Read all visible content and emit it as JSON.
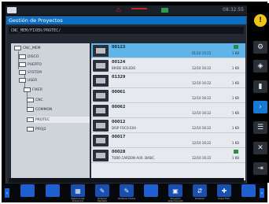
{
  "topbar": {
    "home_label": "",
    "time": "08:32:55"
  },
  "window": {
    "title": "Gestión de Proyectos",
    "path": "CNC_MEM/FIXER/PROTEC/"
  },
  "tree": [
    {
      "label": "CNC_MEM"
    },
    {
      "label": "DISCO"
    },
    {
      "label": "PUERTO"
    },
    {
      "label": "SYSTEM"
    },
    {
      "label": "USER"
    },
    {
      "label": "FIXER"
    },
    {
      "label": "CNC"
    },
    {
      "label": "COMMON"
    },
    {
      "label": "PROTEC"
    },
    {
      "label": "PROJ2"
    }
  ],
  "files": [
    {
      "name": "00123",
      "desc": "",
      "date": "01/10 15:15",
      "size": "1 KB",
      "selected": true
    },
    {
      "name": "00124",
      "desc": "BRIDE SOLEDO",
      "date": "12/10 16:22",
      "size": "1 KB",
      "selected": false
    },
    {
      "name": "01329",
      "desc": "",
      "date": "12/10 16:22",
      "size": "1 KB",
      "selected": false
    },
    {
      "name": "00061",
      "desc": "",
      "date": "12/10 16:22",
      "size": "1 KB",
      "selected": false
    },
    {
      "name": "00062",
      "desc": "",
      "date": "12/10 16:22",
      "size": "1 KB",
      "selected": false
    },
    {
      "name": "00012",
      "desc": "DISP FOCO EXA",
      "date": "12/10 16:22",
      "size": "1 KB",
      "selected": false
    },
    {
      "name": "00017",
      "desc": "",
      "date": "12/10 16:22",
      "size": "1 KB",
      "selected": false
    },
    {
      "name": "00028",
      "desc": "TUBO CARDON AUX. BASIC",
      "date": "12/10 16:22",
      "size": "1 KB",
      "selected": false
    }
  ],
  "sidebar": {
    "icons": [
      "warning-icon",
      "tool-icon",
      "eraser-icon",
      "book-icon",
      "next-icon",
      "list-icon",
      "cross-tools-icon",
      "export-icon"
    ]
  },
  "bottom": {
    "labels": [
      "Seleccionar Directorio",
      "Ordenar Pantalla",
      "Ordenar Fecha",
      "",
      "Proyecto seleccionado",
      "Ordenar",
      "Crear Fich."
    ]
  }
}
